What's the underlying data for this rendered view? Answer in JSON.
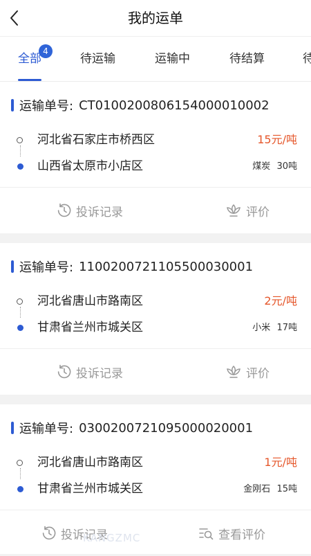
{
  "header": {
    "title": "我的运单"
  },
  "tabs": [
    {
      "label": "全部",
      "badge": "4"
    },
    {
      "label": "待运输"
    },
    {
      "label": "运输中"
    },
    {
      "label": "待结算"
    },
    {
      "label": "待"
    }
  ],
  "orders": [
    {
      "order_label": "运输单号:",
      "order_no": "CT0100200806154000010002",
      "from": "河北省石家庄市桥西区",
      "to": "山西省太原市小店区",
      "price": "15元/吨",
      "cargo": "煤炭",
      "weight": "30吨",
      "actions": {
        "complaint": "投诉记录",
        "review": "评价"
      }
    },
    {
      "order_label": "运输单号:",
      "order_no": "1100200721105500030001",
      "from": "河北省唐山市路南区",
      "to": "甘肃省兰州市城关区",
      "price": "2元/吨",
      "cargo": "小米",
      "weight": "17吨",
      "actions": {
        "complaint": "投诉记录",
        "review": "评价"
      }
    },
    {
      "order_label": "运输单号:",
      "order_no": "0300200721095000020001",
      "from": "河北省唐山市路南区",
      "to": "甘肃省兰州市城关区",
      "price": "1元/吨",
      "cargo": "金刚石",
      "weight": "15吨",
      "actions": {
        "complaint": "投诉记录",
        "review": "查看评价"
      }
    }
  ],
  "watermark": "KANGZMC",
  "colors": {
    "accent": "#2d5bd3",
    "price": "#e5562a",
    "muted": "#999999"
  }
}
